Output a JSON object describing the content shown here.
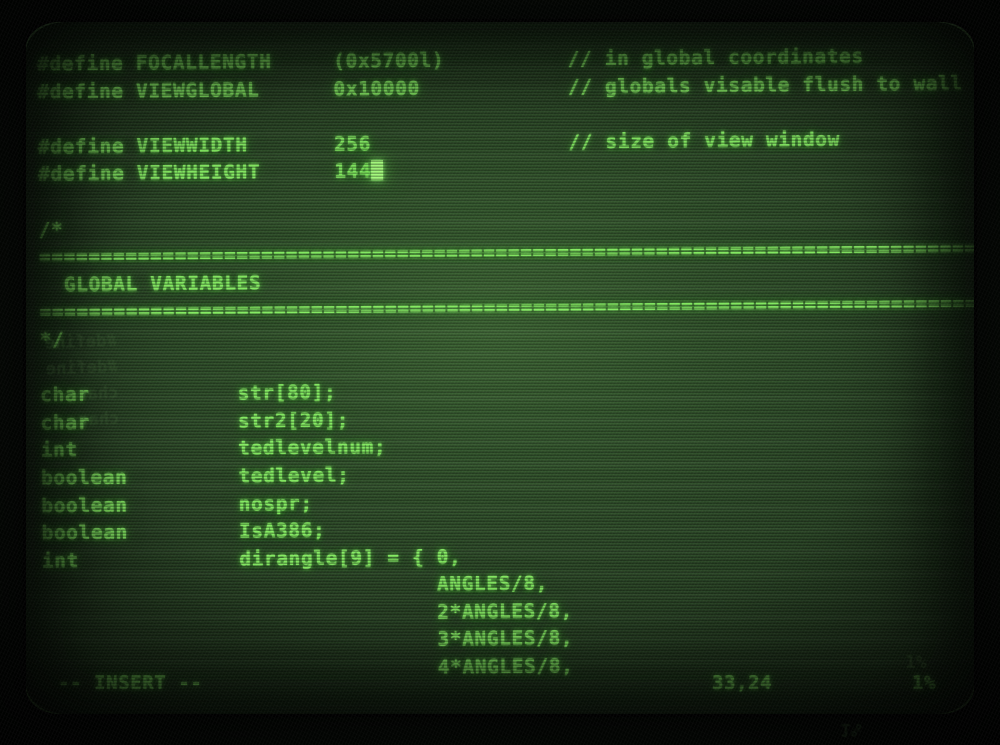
{
  "terminal": {
    "title": "CRT terminal - vim",
    "colors": {
      "phosphor": "#86ee63",
      "screen_bg": "#2f4d2a",
      "bezel": "#030503",
      "cursor": "#a9ff80"
    }
  },
  "editor": {
    "mode_label": "-- INSERT --",
    "cursor_position": "33,24",
    "scroll_percent": "1%",
    "lines": [
      "#define FOCALLENGTH     (0x5700l)          // in global coordinates",
      "#define VIEWGLOBAL      0x10000            // globals visable flush to wall",
      "",
      "#define VIEWWIDTH       256                // size of view window",
      "#define VIEWHEIGHT      144"
    ],
    "comment_block": {
      "open": "/*",
      "rule_top": "=============================================================================",
      "heading": "  GLOBAL VARIABLES",
      "rule_bottom": "=============================================================================",
      "close": "*/"
    },
    "declarations": [
      "char            str[80];",
      "char            str2[20];",
      "int             tedlevelnum;",
      "boolean         tedlevel;",
      "boolean         nospr;",
      "boolean         IsA386;",
      "int             dirangle[9] = { 0,",
      "                                ANGLES/8,",
      "                                2*ANGLES/8,",
      "                                3*ANGLES/8,",
      "                                4*ANGLES/8,"
    ],
    "ghost_reflection": {
      "left": "#define\n#define\nchar\nchar",
      "bottom": "1%",
      "right": "1%"
    }
  }
}
